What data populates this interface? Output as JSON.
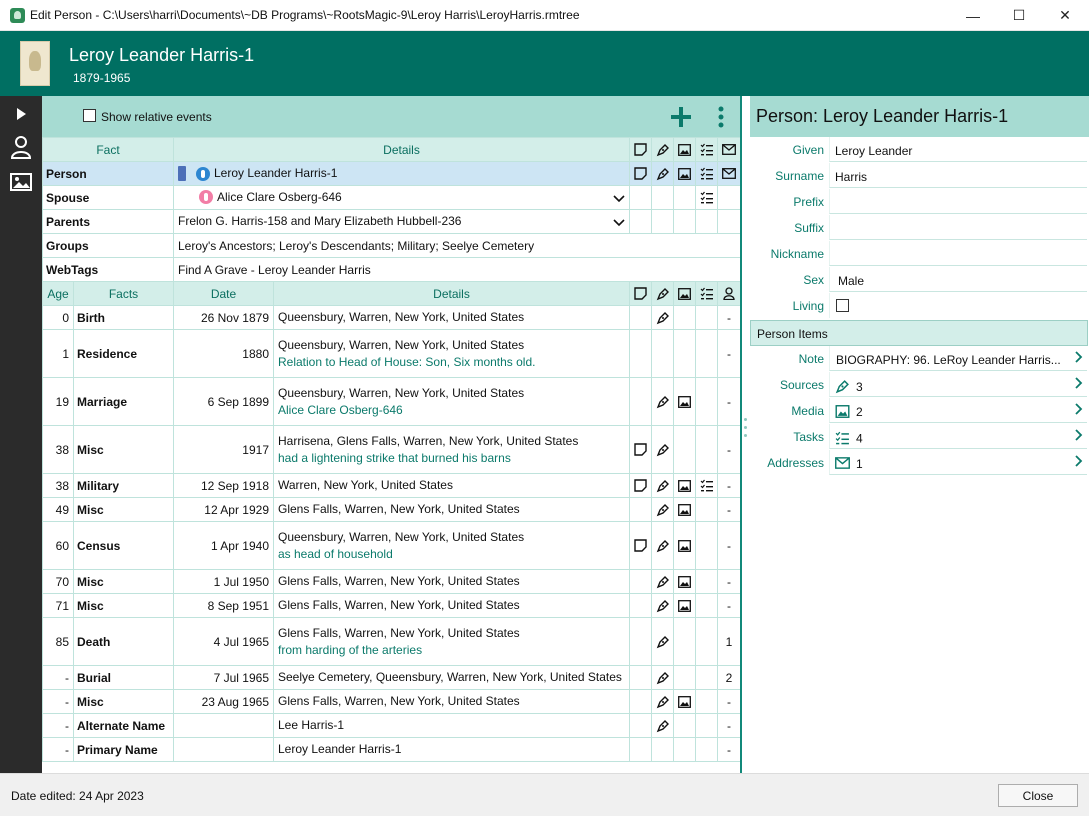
{
  "window": {
    "title": "Edit Person - C:\\Users\\harri\\Documents\\~DB Programs\\~RootsMagic-9\\Leroy Harris\\LeroyHarris.rmtree",
    "minimize": "—",
    "maximize": "☐",
    "close": "✕"
  },
  "header": {
    "name": "Leroy Leander Harris-1",
    "years": "1879-1965"
  },
  "toolbar": {
    "show_relative_label": "Show relative events",
    "show_relative_checked": false
  },
  "top_table": {
    "headers": {
      "fact": "Fact",
      "details": "Details"
    },
    "person": {
      "label": "Person",
      "value": "Leroy Leander Harris-1"
    },
    "spouse": {
      "label": "Spouse",
      "value": "Alice Clare Osberg-646"
    },
    "parents": {
      "label": "Parents",
      "value": "Frelon G. Harris-158 and Mary Elizabeth Hubbell-236"
    },
    "groups": {
      "label": "Groups",
      "value": "Leroy's Ancestors; Leroy's Descendants; Military; Seelye Cemetery"
    },
    "webtags": {
      "label": "WebTags",
      "value": "Find A Grave - Leroy Leander Harris"
    }
  },
  "events_table": {
    "headers": {
      "age": "Age",
      "facts": "Facts",
      "date": "Date",
      "details": "Details"
    },
    "rows": [
      {
        "age": "0",
        "fact": "Birth",
        "date": "26 Nov 1879",
        "place": "Queensbury, Warren, New York, United States",
        "desc": "",
        "count": "-"
      },
      {
        "age": "1",
        "fact": "Residence",
        "date": "1880",
        "place": "Queensbury, Warren, New York, United States",
        "desc": "Relation to Head of House: Son, Six months old.",
        "count": "-"
      },
      {
        "age": "19",
        "fact": "Marriage",
        "date": "6 Sep 1899",
        "place": "Queensbury, Warren, New York, United States",
        "desc": "Alice Clare Osberg-646",
        "count": "-"
      },
      {
        "age": "38",
        "fact": "Misc",
        "date": "1917",
        "place": "Harrisena, Glens Falls, Warren, New York, United States",
        "desc": "had a  lightening strike that burned his barns",
        "count": "-"
      },
      {
        "age": "38",
        "fact": "Military",
        "date": "12 Sep 1918",
        "place": "Warren, New York, United States",
        "desc": "",
        "count": "-"
      },
      {
        "age": "49",
        "fact": "Misc",
        "date": "12 Apr 1929",
        "place": "Glens Falls, Warren, New York, United States",
        "desc": "",
        "count": "-"
      },
      {
        "age": "60",
        "fact": "Census",
        "date": "1 Apr 1940",
        "place": "Queensbury, Warren, New York, United States",
        "desc": "as head of household",
        "count": "-"
      },
      {
        "age": "70",
        "fact": "Misc",
        "date": "1 Jul 1950",
        "place": "Glens Falls, Warren, New York, United States",
        "desc": "",
        "count": "-"
      },
      {
        "age": "71",
        "fact": "Misc",
        "date": "8 Sep 1951",
        "place": "Glens Falls, Warren, New York, United States",
        "desc": "",
        "count": "-"
      },
      {
        "age": "85",
        "fact": "Death",
        "date": "4 Jul 1965",
        "place": "Glens Falls, Warren, New York, United States",
        "desc": "from harding of the arteries",
        "count": "1"
      },
      {
        "age": "-",
        "fact": "Burial",
        "date": "7 Jul 1965",
        "place": "Seelye Cemetery, Queensbury, Warren, New York, United States",
        "desc": "",
        "count": "2"
      },
      {
        "age": "-",
        "fact": "Misc",
        "date": "23 Aug 1965",
        "place": "Glens Falls, Warren, New York, United States",
        "desc": "",
        "count": "-"
      },
      {
        "age": "-",
        "fact": "Alternate Name",
        "date": "",
        "place": "Lee Harris-1",
        "desc": "",
        "count": "-"
      },
      {
        "age": "-",
        "fact": "Primary Name",
        "date": "",
        "place": "Leroy Leander Harris-1",
        "desc": "",
        "count": "-"
      }
    ]
  },
  "right_panel": {
    "title": "Person: Leroy Leander Harris-1",
    "given": {
      "label": "Given",
      "value": "Leroy Leander"
    },
    "surname": {
      "label": "Surname",
      "value": "Harris"
    },
    "prefix": {
      "label": "Prefix",
      "value": ""
    },
    "suffix": {
      "label": "Suffix",
      "value": ""
    },
    "nickname": {
      "label": "Nickname",
      "value": ""
    },
    "sex": {
      "label": "Sex",
      "value": "Male"
    },
    "living": {
      "label": "Living",
      "checked": false
    },
    "items_header": "Person Items",
    "note": {
      "label": "Note",
      "value": "BIOGRAPHY:      96.  LeRoy Leander Harris..."
    },
    "sources": {
      "label": "Sources",
      "value": "3"
    },
    "media": {
      "label": "Media",
      "value": "2"
    },
    "tasks": {
      "label": "Tasks",
      "value": "4"
    },
    "addresses": {
      "label": "Addresses",
      "value": "1"
    }
  },
  "status": {
    "date_edited": "Date edited: 24 Apr 2023",
    "close_label": "Close"
  },
  "colors": {
    "header_bg": "#006f62",
    "toolbar_bg": "#a6dbd2",
    "accent_text": "#0b7a6b",
    "rail_bg": "#2b2b2b",
    "selected_row": "#cde5f4"
  }
}
